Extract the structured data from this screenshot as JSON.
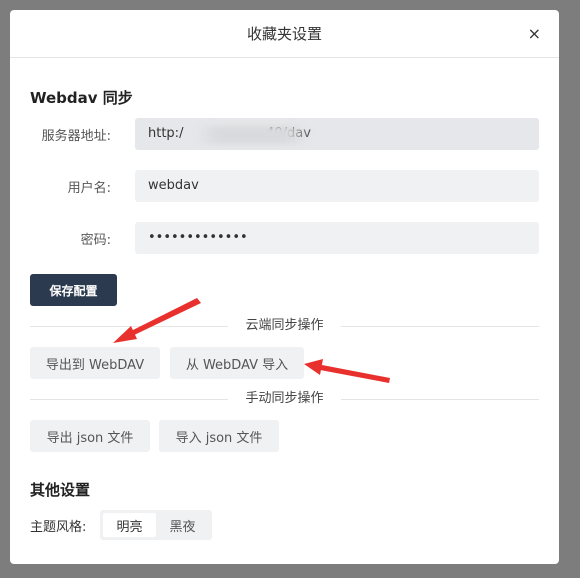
{
  "modal": {
    "title": "收藏夹设置",
    "close_symbol": "×"
  },
  "webdav": {
    "section_title": "Webdav 同步",
    "server_label": "服务器地址:",
    "server_value": "http:/                    40/dav",
    "username_label": "用户名:",
    "username_value": "webdav",
    "password_label": "密码:",
    "password_value": "•••••••••••••",
    "save_label": "保存配置"
  },
  "cloud_sync": {
    "divider_label": "云端同步操作",
    "export_label": "导出到 WebDAV",
    "import_label": "从 WebDAV 导入"
  },
  "manual_sync": {
    "divider_label": "手动同步操作",
    "export_label": "导出 json 文件",
    "import_label": "导入 json 文件"
  },
  "other": {
    "section_title": "其他设置",
    "theme_label": "主题风格:",
    "theme_options": [
      "明亮",
      "黑夜"
    ],
    "theme_selected": "明亮"
  },
  "colors": {
    "overlay": "#7d7d7d",
    "primary_button": "#2c3a4f",
    "annotation_arrow": "#e8302c"
  }
}
